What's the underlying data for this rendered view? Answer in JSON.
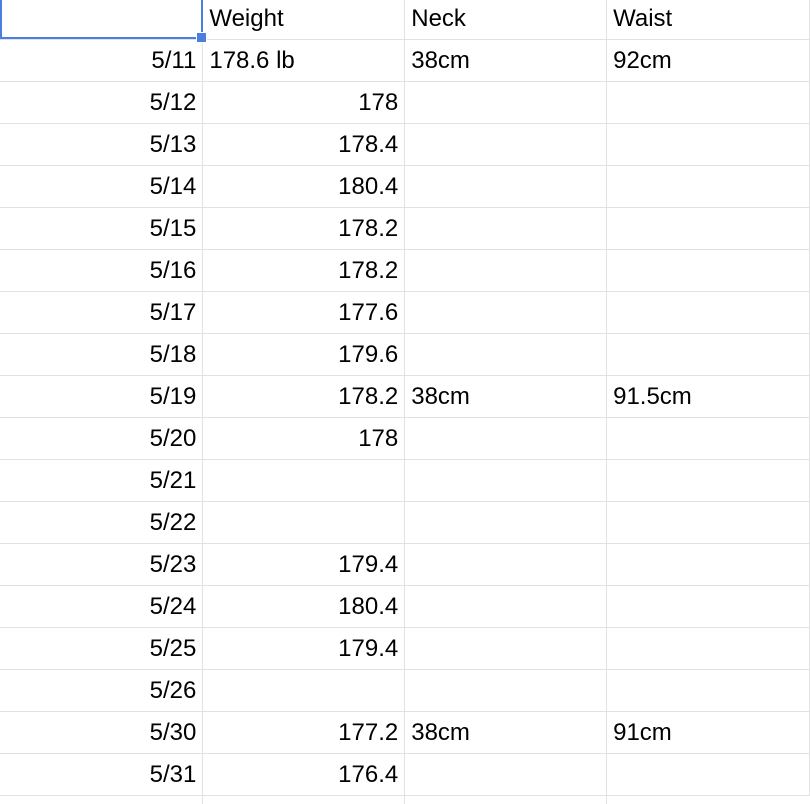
{
  "header": {
    "a": "",
    "weight": "Weight",
    "neck": "Neck",
    "waist": "Waist"
  },
  "rows": [
    {
      "date": "5/11",
      "weight": "178.6 lb",
      "neck": "38cm",
      "waist": "92cm"
    },
    {
      "date": "5/12",
      "weight": "178",
      "neck": "",
      "waist": ""
    },
    {
      "date": "5/13",
      "weight": "178.4",
      "neck": "",
      "waist": ""
    },
    {
      "date": "5/14",
      "weight": "180.4",
      "neck": "",
      "waist": ""
    },
    {
      "date": "5/15",
      "weight": "178.2",
      "neck": "",
      "waist": ""
    },
    {
      "date": "5/16",
      "weight": "178.2",
      "neck": "",
      "waist": ""
    },
    {
      "date": "5/17",
      "weight": "177.6",
      "neck": "",
      "waist": ""
    },
    {
      "date": "5/18",
      "weight": "179.6",
      "neck": "",
      "waist": ""
    },
    {
      "date": "5/19",
      "weight": "178.2",
      "neck": "38cm",
      "waist": "91.5cm"
    },
    {
      "date": "5/20",
      "weight": "178",
      "neck": "",
      "waist": ""
    },
    {
      "date": "5/21",
      "weight": "",
      "neck": "",
      "waist": ""
    },
    {
      "date": "5/22",
      "weight": "",
      "neck": "",
      "waist": ""
    },
    {
      "date": "5/23",
      "weight": "179.4",
      "neck": "",
      "waist": ""
    },
    {
      "date": "5/24",
      "weight": "180.4",
      "neck": "",
      "waist": ""
    },
    {
      "date": "5/25",
      "weight": "179.4",
      "neck": "",
      "waist": ""
    },
    {
      "date": "5/26",
      "weight": "",
      "neck": "",
      "waist": ""
    },
    {
      "date": "5/30",
      "weight": "177.2",
      "neck": "38cm",
      "waist": "91cm"
    },
    {
      "date": "5/31",
      "weight": "176.4",
      "neck": "",
      "waist": ""
    }
  ],
  "selection": {
    "active_cell": "header.a",
    "accent": "#4a7ee0"
  },
  "colors": {
    "gridline": "#e2e2e2",
    "text": "#000000"
  }
}
